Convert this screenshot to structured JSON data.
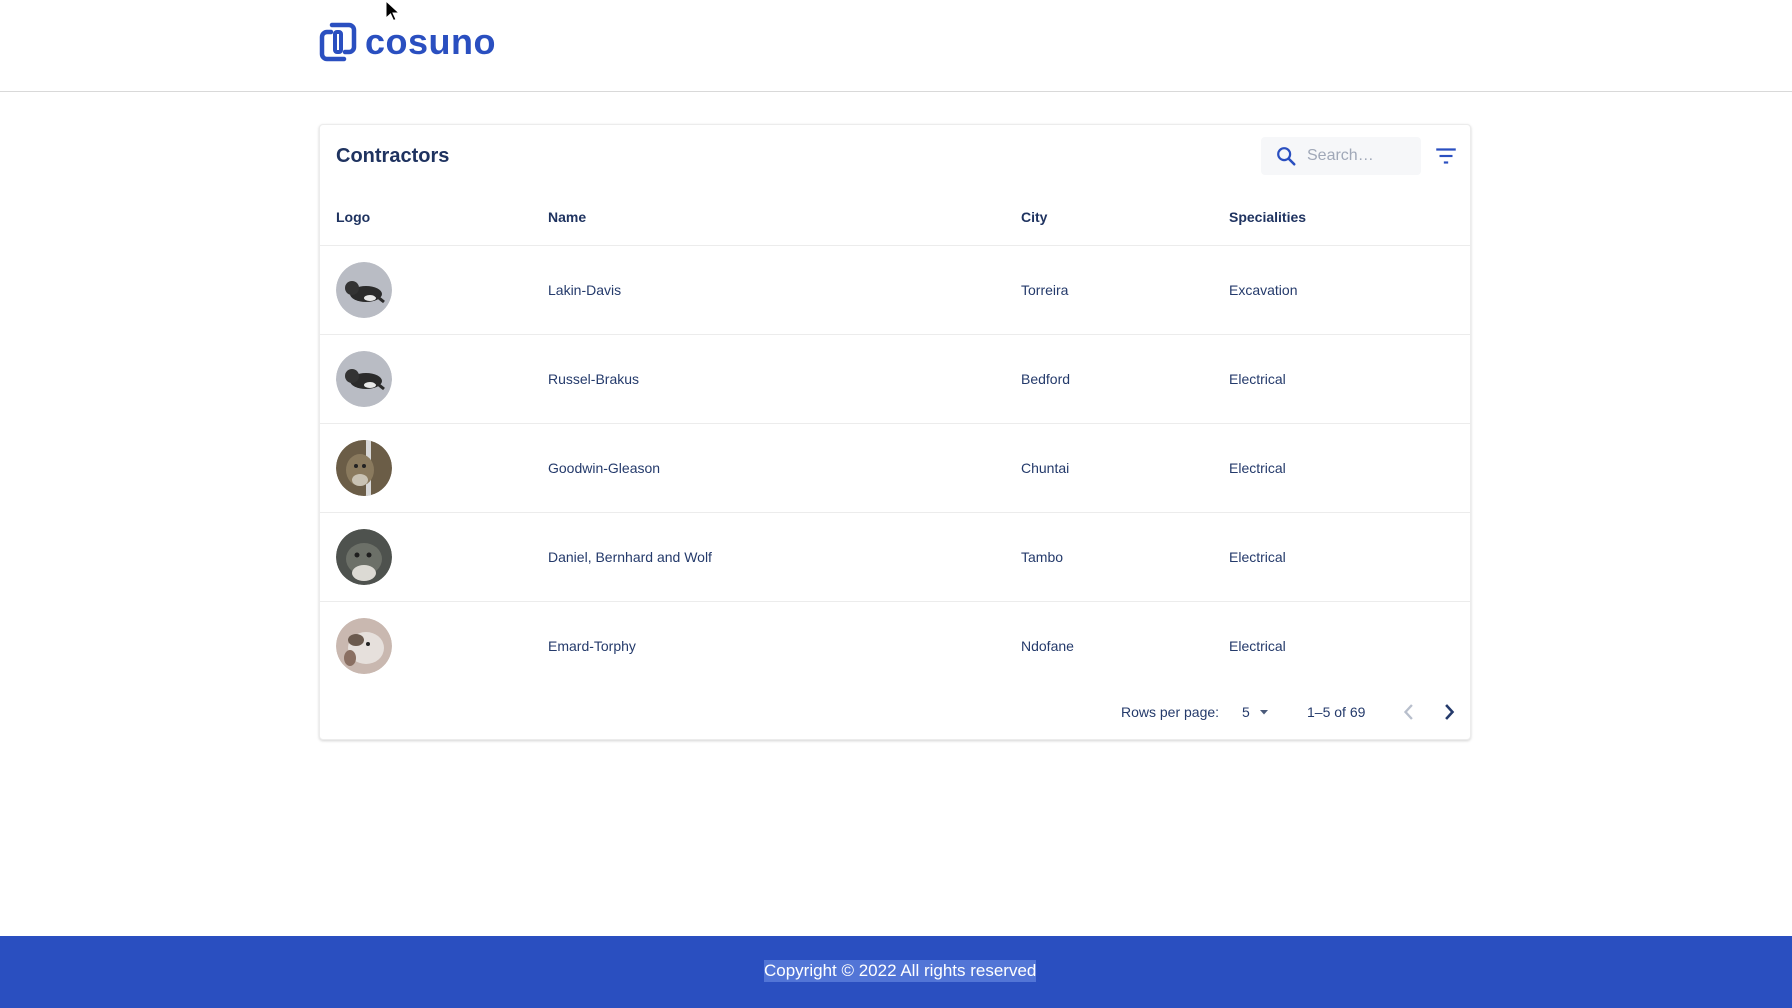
{
  "brand": {
    "name": "cosuno",
    "color": "#2a4fc0"
  },
  "card": {
    "title": "Contractors"
  },
  "search": {
    "placeholder": "Search…",
    "value": ""
  },
  "table": {
    "columns": [
      "Logo",
      "Name",
      "City",
      "Specialities"
    ],
    "rows": [
      {
        "name": "Lakin-Davis",
        "city": "Torreira",
        "speciality": "Excavation"
      },
      {
        "name": "Russel-Brakus",
        "city": "Bedford",
        "speciality": "Electrical"
      },
      {
        "name": "Goodwin-Gleason",
        "city": "Chuntai",
        "speciality": "Electrical"
      },
      {
        "name": "Daniel, Bernhard and Wolf",
        "city": "Tambo",
        "speciality": "Electrical"
      },
      {
        "name": "Emard-Torphy",
        "city": "Ndofane",
        "speciality": "Electrical"
      }
    ]
  },
  "pagination": {
    "rows_per_page_label": "Rows per page:",
    "rows_per_page_value": "5",
    "range": "1–5 of 69"
  },
  "footer": {
    "text": "Copyright © 2022 All rights reserved",
    "background": "#2a4fc0"
  }
}
